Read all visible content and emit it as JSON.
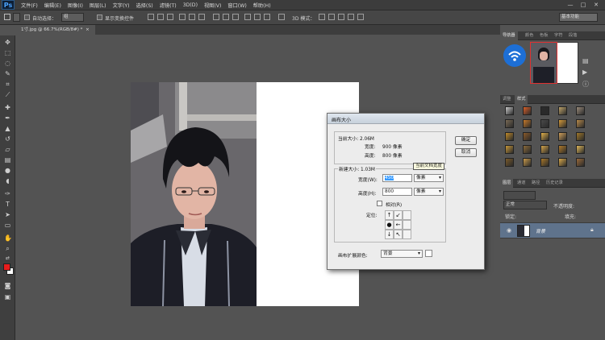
{
  "app": {
    "logo": "Ps"
  },
  "menu": [
    "文件(F)",
    "编辑(E)",
    "图像(I)",
    "图层(L)",
    "文字(Y)",
    "选择(S)",
    "滤镜(T)",
    "3D(D)",
    "视图(V)",
    "窗口(W)",
    "帮助(H)"
  ],
  "window_controls": {
    "minimize": "—",
    "maximize": "□",
    "close": "✕"
  },
  "options_bar": {
    "auto_select_label": "自动选择：",
    "auto_select_value": "组",
    "show_transform_label": "显示变换控件",
    "mode_3d_label": "3D 模式：",
    "workspace": "基本功能"
  },
  "document_tab": {
    "label": "1寸.jpg @ 66.7%(RGB/8#) *",
    "close": "×"
  },
  "dialog": {
    "title": "画布大小",
    "current_size_label": "当前大小: 2.06M",
    "current_width_label": "宽度:",
    "current_width_value": "900 像素",
    "current_height_label": "高度:",
    "current_height_value": "800 像素",
    "new_size_label": "新建大小: 1.03M",
    "width_label": "宽度(W):",
    "width_value": "450",
    "width_unit": "像素",
    "height_label": "高度(H):",
    "height_value": "800",
    "height_unit": "像素",
    "relative_label": "相对(R)",
    "anchor_label": "定位:",
    "extension_color_label": "画布扩展颜色:",
    "extension_color_value": "背景",
    "ok": "确定",
    "cancel": "取消",
    "tooltip": "当前文档宽度"
  },
  "right_panel": {
    "top_tabs": [
      "导航器",
      "颜色",
      "色板",
      "字符",
      "段落"
    ],
    "styles_tabs": [
      "调整",
      "样式"
    ],
    "layers_tabs": [
      "图层",
      "通道",
      "路径",
      "历史记录"
    ],
    "blend_mode": "正常",
    "opacity_label": "不透明度:",
    "lock_label": "锁定:",
    "fill_label": "填充:",
    "layer_name": "背景"
  },
  "colors": {
    "accent": "#5f738c",
    "foreground": "#e81c1c",
    "background": "#ffffff",
    "nav_frame": "#e03030"
  }
}
